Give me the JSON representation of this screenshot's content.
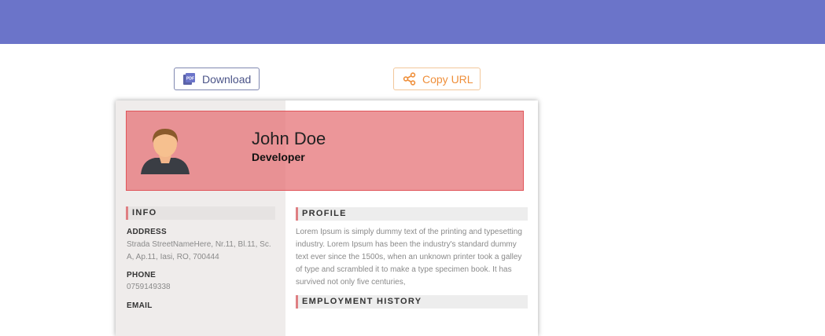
{
  "colors": {
    "topbar": "#6b74c9",
    "header_fill": "#e46e72",
    "accent_bar": "#df7f83",
    "download_text": "#4b5488",
    "copy_text": "#ef8f3a"
  },
  "actions": {
    "download_label": "Download",
    "download_icon": "pdf-icon",
    "copy_label": "Copy URL",
    "copy_icon": "share-icon"
  },
  "resume": {
    "name": "John Doe",
    "role": "Developer",
    "avatar_icon": "user-avatar-icon",
    "info": {
      "title": "INFO",
      "address_label": "ADDRESS",
      "address_value": "Strada StreetNameHere, Nr.11, Bl.11, Sc. A, Ap.11, Iasi, RO, 700444",
      "phone_label": "PHONE",
      "phone_value": "0759149338",
      "email_label": "EMAIL"
    },
    "profile": {
      "title": "PROFILE",
      "text": "Lorem Ipsum is simply dummy text of the printing and typesetting industry. Lorem Ipsum has been the industry's standard dummy text ever since the 1500s, when an unknown printer took a galley of type and scrambled it to make a type specimen book. It has survived not only five centuries,"
    },
    "employment": {
      "title": "EMPLOYMENT HISTORY"
    }
  }
}
